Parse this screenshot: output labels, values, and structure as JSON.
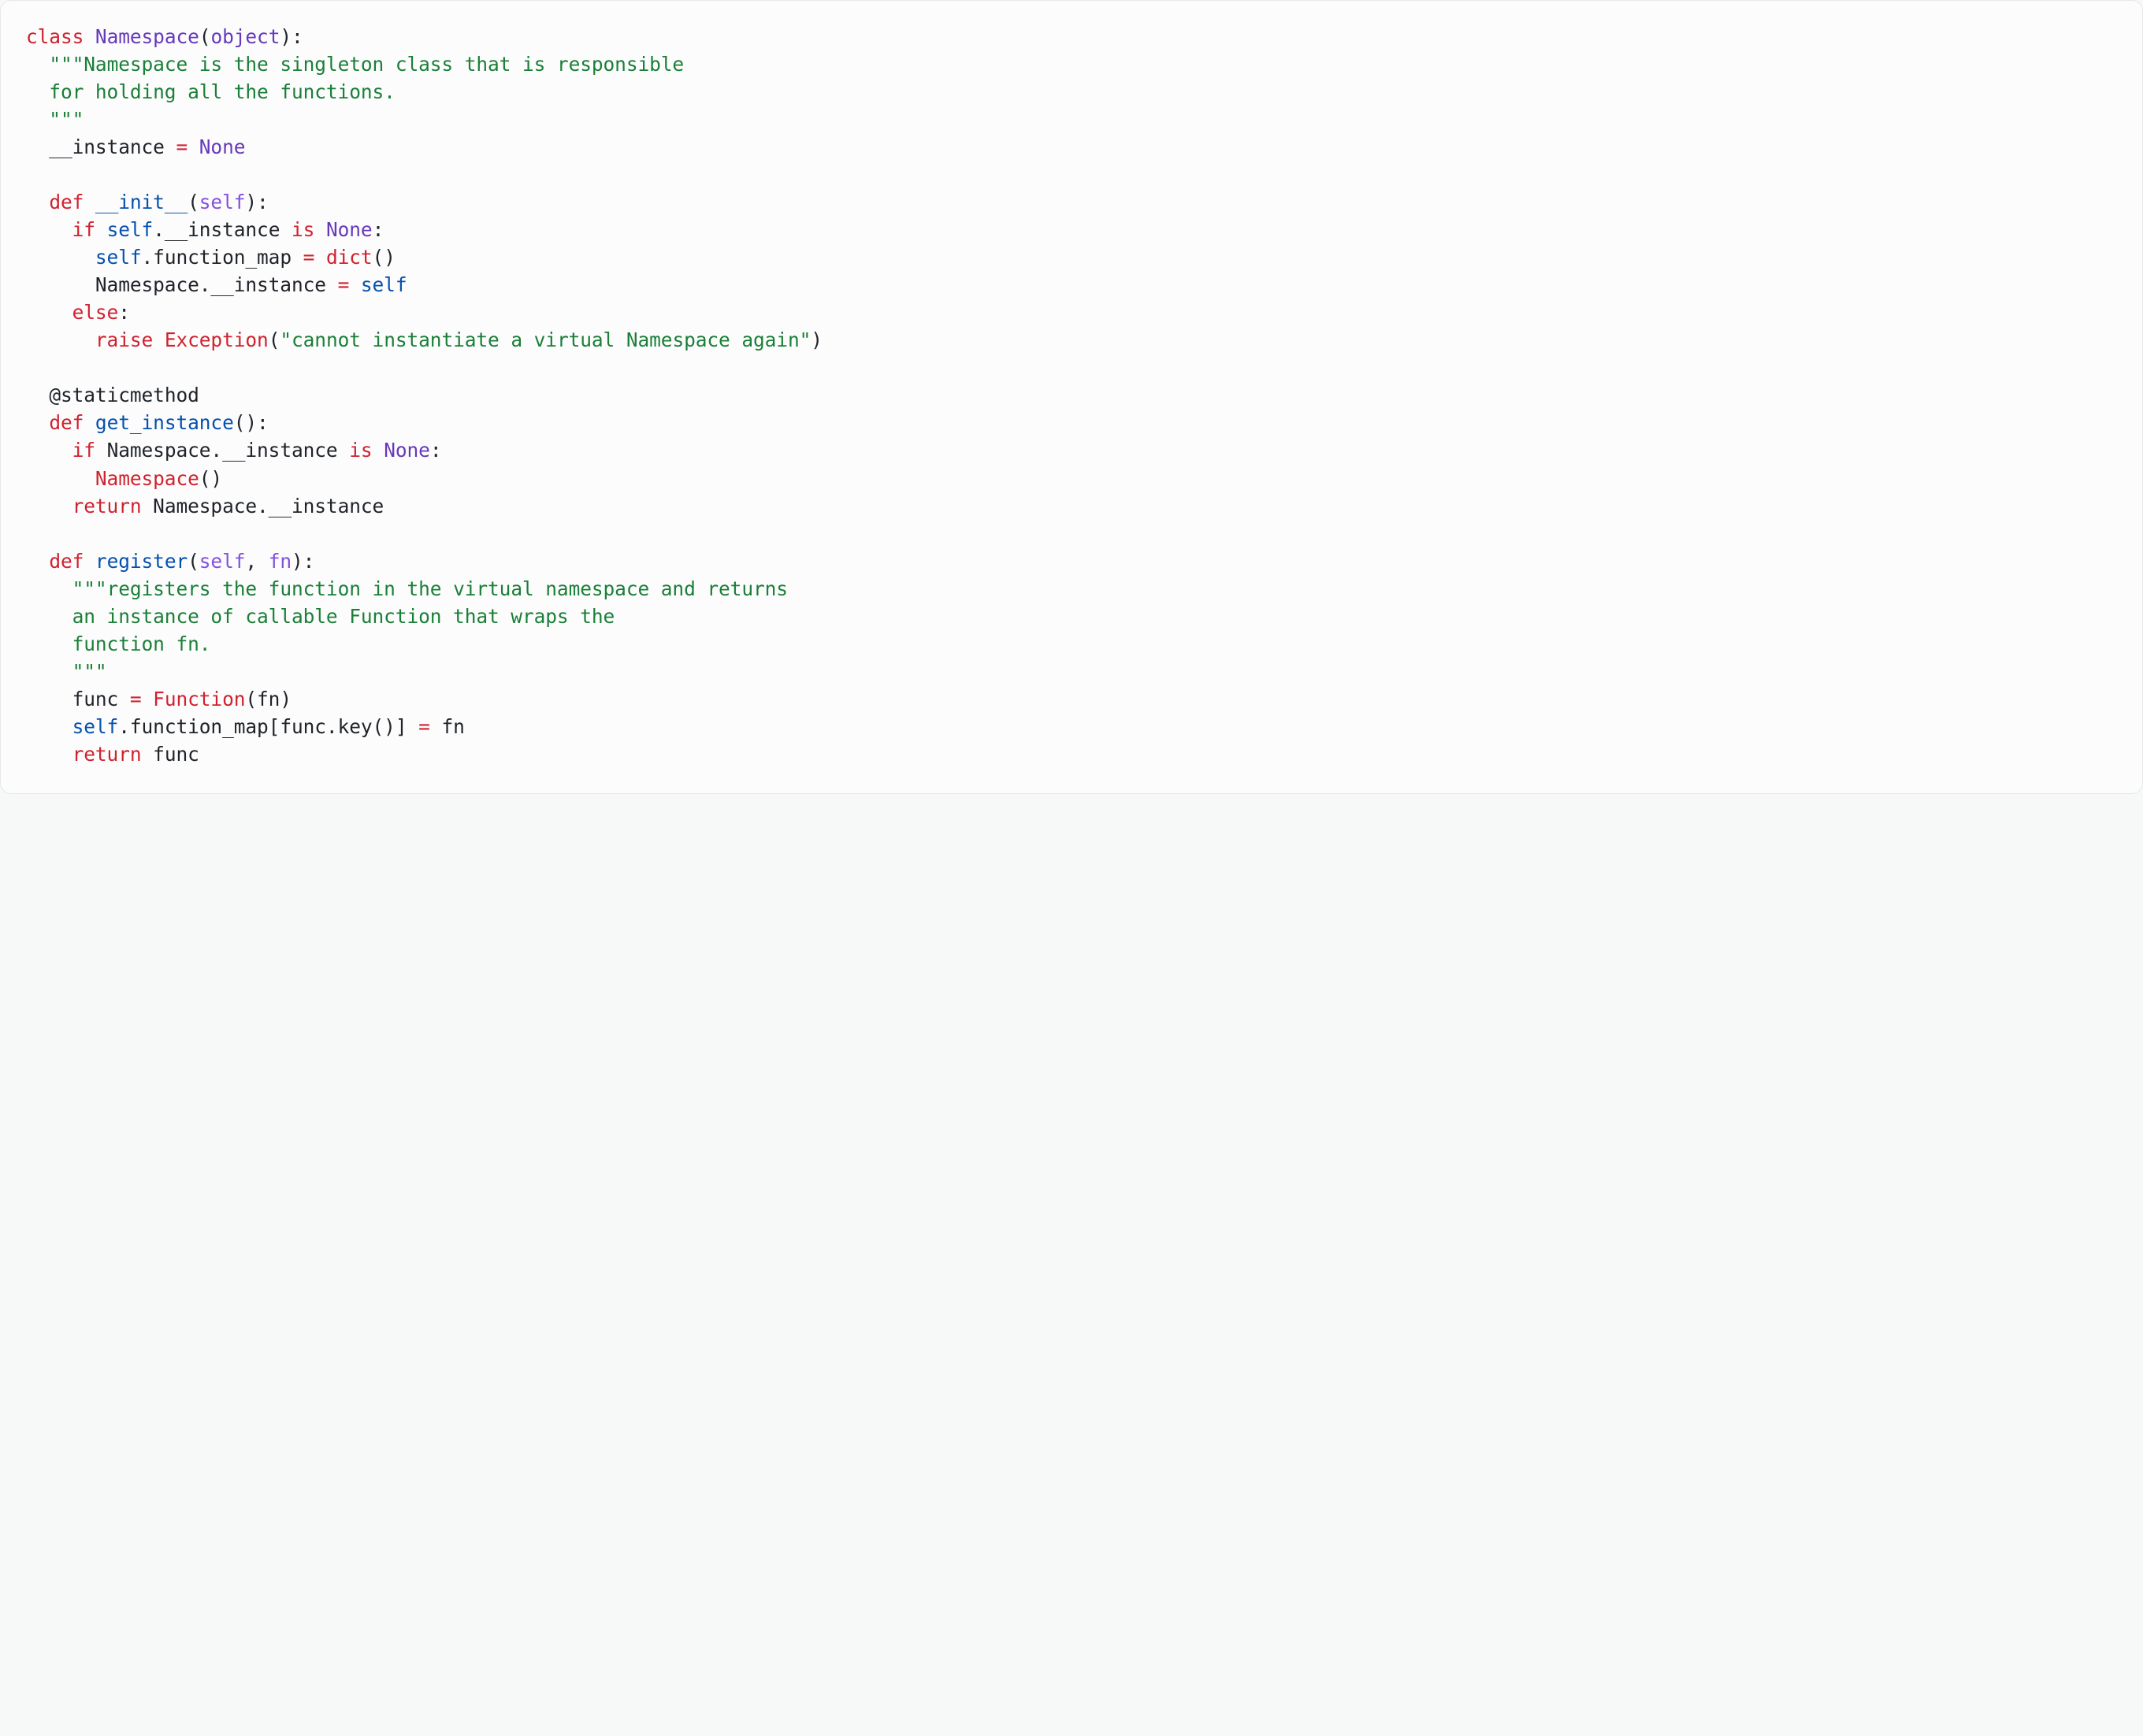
{
  "code": {
    "tokens": [
      {
        "t": "class",
        "c": "kw"
      },
      {
        "t": " "
      },
      {
        "t": "Namespace",
        "c": "cls"
      },
      {
        "t": "("
      },
      {
        "t": "object",
        "c": "bi"
      },
      {
        "t": "):"
      },
      {
        "t": "\n"
      },
      {
        "t": "  "
      },
      {
        "t": "\"\"\"Namespace is the singleton class that is responsible\n  for holding all the functions.\n  \"\"\"",
        "c": "str"
      },
      {
        "t": "\n"
      },
      {
        "t": "  __instance "
      },
      {
        "t": "=",
        "c": "kw"
      },
      {
        "t": " "
      },
      {
        "t": "None",
        "c": "bi"
      },
      {
        "t": "\n"
      },
      {
        "t": "\n"
      },
      {
        "t": "  "
      },
      {
        "t": "def",
        "c": "kw"
      },
      {
        "t": " "
      },
      {
        "t": "__init__",
        "c": "fn"
      },
      {
        "t": "("
      },
      {
        "t": "self",
        "c": "self"
      },
      {
        "t": "):"
      },
      {
        "t": "\n"
      },
      {
        "t": "    "
      },
      {
        "t": "if",
        "c": "kw"
      },
      {
        "t": " "
      },
      {
        "t": "self",
        "c": "fn"
      },
      {
        "t": ".__instance "
      },
      {
        "t": "is",
        "c": "kw"
      },
      {
        "t": " "
      },
      {
        "t": "None",
        "c": "bi"
      },
      {
        "t": ":"
      },
      {
        "t": "\n"
      },
      {
        "t": "      "
      },
      {
        "t": "self",
        "c": "fn"
      },
      {
        "t": ".function_map "
      },
      {
        "t": "=",
        "c": "kw"
      },
      {
        "t": " "
      },
      {
        "t": "dict",
        "c": "call"
      },
      {
        "t": "()"
      },
      {
        "t": "\n"
      },
      {
        "t": "      Namespace.__instance "
      },
      {
        "t": "=",
        "c": "kw"
      },
      {
        "t": " "
      },
      {
        "t": "self",
        "c": "fn"
      },
      {
        "t": "\n"
      },
      {
        "t": "    "
      },
      {
        "t": "else",
        "c": "kw"
      },
      {
        "t": ":"
      },
      {
        "t": "\n"
      },
      {
        "t": "      "
      },
      {
        "t": "raise",
        "c": "kw"
      },
      {
        "t": " "
      },
      {
        "t": "Exception",
        "c": "call"
      },
      {
        "t": "("
      },
      {
        "t": "\"cannot instantiate a virtual Namespace again\"",
        "c": "str"
      },
      {
        "t": ")"
      },
      {
        "t": "\n"
      },
      {
        "t": "\n"
      },
      {
        "t": "  "
      },
      {
        "t": "@staticmethod",
        "c": "deco"
      },
      {
        "t": "\n"
      },
      {
        "t": "  "
      },
      {
        "t": "def",
        "c": "kw"
      },
      {
        "t": " "
      },
      {
        "t": "get_instance",
        "c": "fn"
      },
      {
        "t": "():"
      },
      {
        "t": "\n"
      },
      {
        "t": "    "
      },
      {
        "t": "if",
        "c": "kw"
      },
      {
        "t": " Namespace.__instance "
      },
      {
        "t": "is",
        "c": "kw"
      },
      {
        "t": " "
      },
      {
        "t": "None",
        "c": "bi"
      },
      {
        "t": ":"
      },
      {
        "t": "\n"
      },
      {
        "t": "      "
      },
      {
        "t": "Namespace",
        "c": "call"
      },
      {
        "t": "()"
      },
      {
        "t": "\n"
      },
      {
        "t": "    "
      },
      {
        "t": "return",
        "c": "kw"
      },
      {
        "t": " Namespace.__instance"
      },
      {
        "t": "\n"
      },
      {
        "t": "\n"
      },
      {
        "t": "  "
      },
      {
        "t": "def",
        "c": "kw"
      },
      {
        "t": " "
      },
      {
        "t": "register",
        "c": "fn"
      },
      {
        "t": "("
      },
      {
        "t": "self",
        "c": "self"
      },
      {
        "t": ", "
      },
      {
        "t": "fn",
        "c": "self"
      },
      {
        "t": "):"
      },
      {
        "t": "\n"
      },
      {
        "t": "    "
      },
      {
        "t": "\"\"\"registers the function in the virtual namespace and returns\n    an instance of callable Function that wraps the\n    function fn.\n    \"\"\"",
        "c": "str"
      },
      {
        "t": "\n"
      },
      {
        "t": "    func "
      },
      {
        "t": "=",
        "c": "kw"
      },
      {
        "t": " "
      },
      {
        "t": "Function",
        "c": "call"
      },
      {
        "t": "(fn)"
      },
      {
        "t": "\n"
      },
      {
        "t": "    "
      },
      {
        "t": "self",
        "c": "fn"
      },
      {
        "t": ".function_map[func.key()] "
      },
      {
        "t": "=",
        "c": "kw"
      },
      {
        "t": " fn"
      },
      {
        "t": "\n"
      },
      {
        "t": "    "
      },
      {
        "t": "return",
        "c": "kw"
      },
      {
        "t": " func"
      }
    ]
  }
}
